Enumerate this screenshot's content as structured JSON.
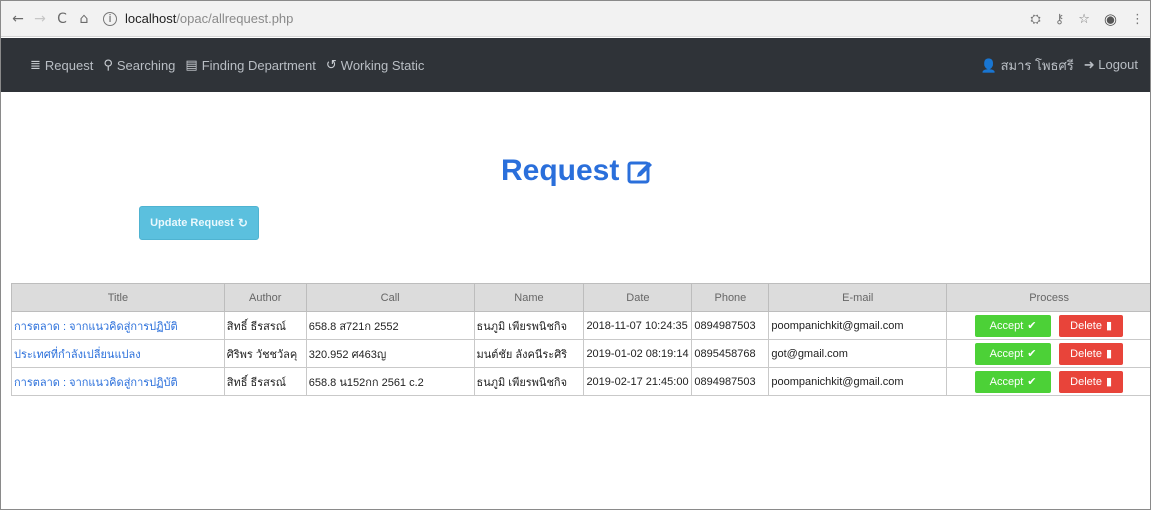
{
  "browser": {
    "back": "←",
    "forward": "→",
    "reload": "C",
    "home": "⌂",
    "url_host": "localhost",
    "url_path": "/opac/allrequest.php"
  },
  "navbar": {
    "items": [
      {
        "icon": "≣",
        "label": "Request"
      },
      {
        "icon": "⚲",
        "label": "Searching"
      },
      {
        "icon": "▤",
        "label": "Finding Department"
      },
      {
        "icon": "↺",
        "label": "Working Static"
      }
    ],
    "user_icon": "👤",
    "user_name": "สมาร โพธศรี",
    "logout_icon": "➜",
    "logout_label": "Logout"
  },
  "page": {
    "title": "Request",
    "update_button": "Update Request",
    "update_icon": "↻"
  },
  "table": {
    "headers": [
      "Title",
      "Author",
      "Call",
      "Name",
      "Date",
      "Phone",
      "E-mail",
      "Process"
    ],
    "rows": [
      {
        "title": "การตลาด : จากแนวคิดสู่การปฏิบัติ",
        "author": "สิทธิ์ ธีรสรณ์",
        "call": "658.8 ส721ก 2552",
        "name": "ธนภูมิ เพียรพนิชกิจ",
        "date": "2018-11-07 10:24:35",
        "phone": "0894987503",
        "email": "poompanichkit@gmail.com"
      },
      {
        "title": "ประเทศที่กำลังเปลี่ยนแปลง",
        "author": "ศิริพร วัชชวัลคุ",
        "call": "320.952 ศ463ญ",
        "name": "มนต์ชัย ลังคนีระศิริ",
        "date": "2019-01-02 08:19:14",
        "phone": "0895458768",
        "email": "got@gmail.com"
      },
      {
        "title": "การตลาด : จากแนวคิดสู่การปฏิบัติ",
        "author": "สิทธิ์ ธีรสรณ์",
        "call": "658.8 น152กก 2561 c.2",
        "name": "ธนภูมิ เพียรพนิชกิจ",
        "date": "2019-02-17 21:45:00",
        "phone": "0894987503",
        "email": "poompanichkit@gmail.com"
      }
    ],
    "accept_label": "Accept",
    "delete_label": "Delete"
  },
  "colors": {
    "navbar": "#2f3338",
    "title": "#2a6fdb",
    "update": "#5bc0de",
    "accept": "#4cd137",
    "delete": "#e8443a"
  }
}
